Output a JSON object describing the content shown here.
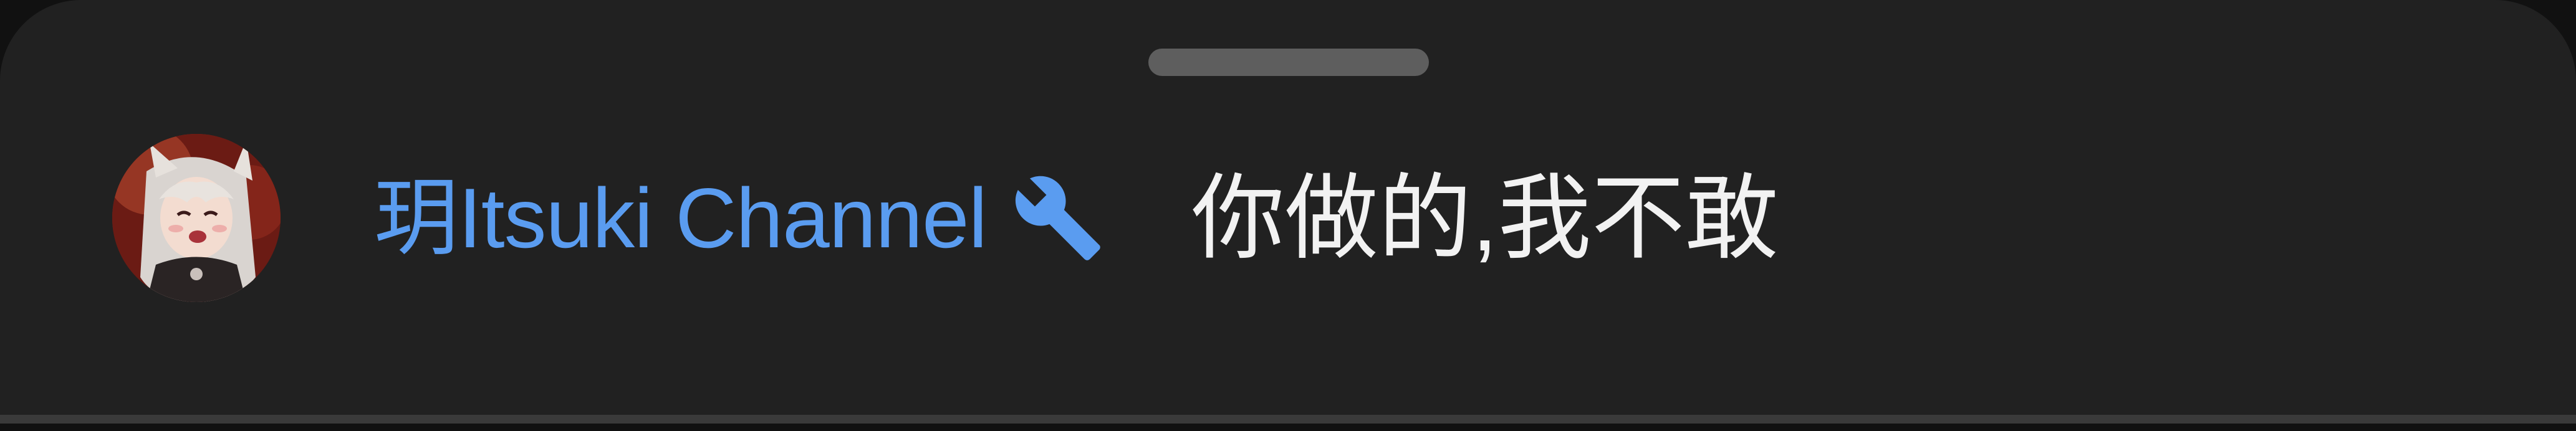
{
  "comment": {
    "author_name": "玥Itsuki Channel",
    "author_badge_icon": "wrench-icon",
    "text": "你做的,我不敢"
  },
  "colors": {
    "background": "#212121",
    "author_name": "#5a9cf0",
    "comment_text": "#f2f2f2",
    "drag_handle": "#5e5e5e"
  }
}
